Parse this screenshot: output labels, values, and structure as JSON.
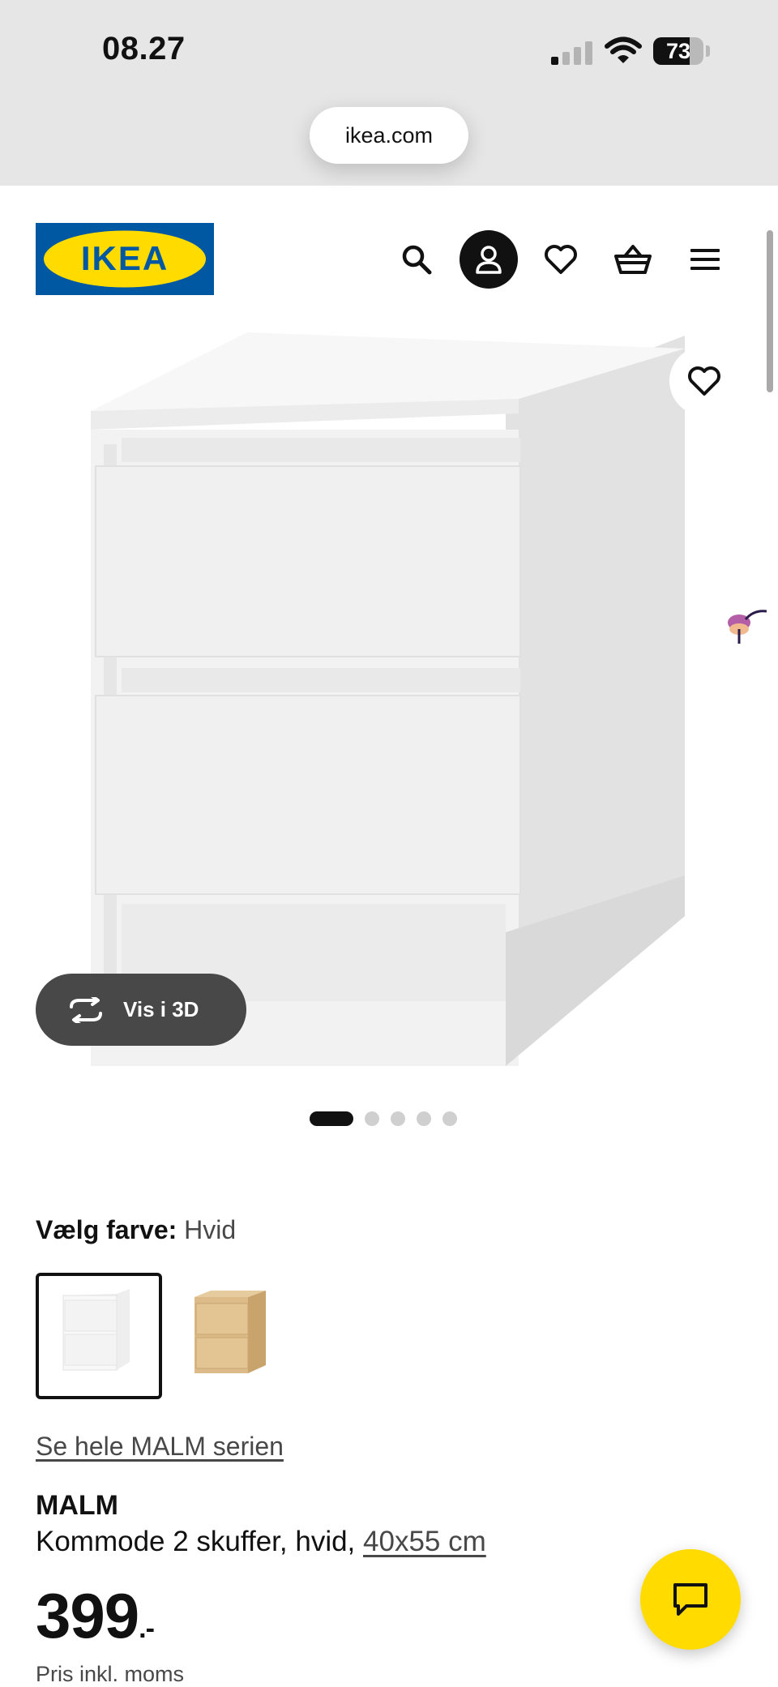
{
  "status_bar": {
    "time": "08.27",
    "battery_level": "73",
    "battery_fraction": 0.73
  },
  "browser": {
    "url": "ikea.com"
  },
  "header": {
    "logo_text": "IKEA",
    "icons": [
      "search-icon",
      "user-icon",
      "heart-icon",
      "basket-icon",
      "menu-icon"
    ]
  },
  "gallery": {
    "view_3d_label": "Vis i 3D",
    "image_count": 5,
    "active_index": 0
  },
  "product": {
    "color_label": "Vælg farve:",
    "color_value": "Hvid",
    "swatches": [
      {
        "name": "Hvid",
        "color": "#f4f4f4",
        "selected": true
      },
      {
        "name": "Eg",
        "color": "#d9b886",
        "selected": false
      }
    ],
    "series_link": "Se hele MALM serien",
    "name": "MALM",
    "description": "Kommode 2 skuffer, hvid,",
    "size": "40x55 cm",
    "price": "399",
    "price_suffix": ".-",
    "price_note": "Pris inkl. moms"
  },
  "colors": {
    "ikea_blue": "#0058a3",
    "ikea_yellow": "#ffdb00",
    "text_dark": "#111111",
    "text_grey": "#484848"
  }
}
